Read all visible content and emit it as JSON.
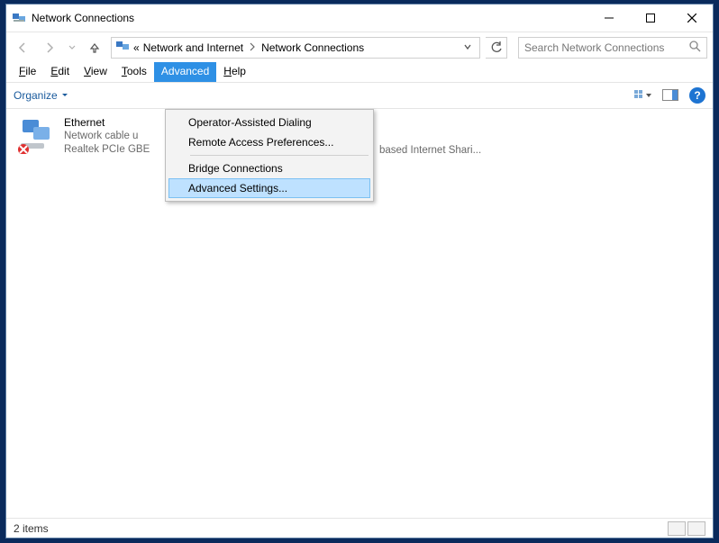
{
  "window": {
    "title": "Network Connections"
  },
  "address": {
    "prefix": "«",
    "seg1": "Network and Internet",
    "seg2": "Network Connections"
  },
  "search": {
    "placeholder": "Search Network Connections"
  },
  "menu": {
    "file": "File",
    "edit": "Edit",
    "view": "View",
    "tools": "Tools",
    "advanced": "Advanced",
    "help": "Help"
  },
  "toolbar": {
    "organize": "Organize"
  },
  "dropdown": {
    "item1": "Operator-Assisted Dialing",
    "item2": "Remote Access Preferences...",
    "item3": "Bridge Connections",
    "item4": "Advanced Settings..."
  },
  "items": {
    "ethernet": {
      "name": "Ethernet",
      "line2": "Network cable u",
      "line3": "Realtek PCIe GBE"
    },
    "other_line3": "based Internet Shari..."
  },
  "status": {
    "text": "2 items"
  }
}
